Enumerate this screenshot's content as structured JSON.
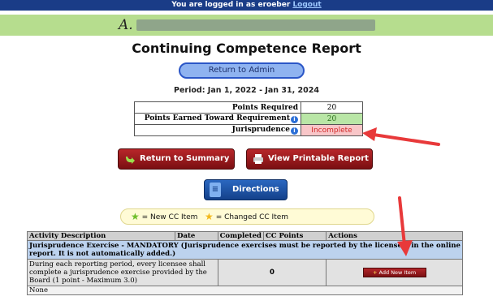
{
  "header": {
    "login_text": "You are logged in as eroeber",
    "logout_label": "Logout",
    "user_initial": "A."
  },
  "page": {
    "title": "Continuing Competence Report",
    "return_admin_label": "Return to Admin",
    "period": "Period: Jan 1, 2022 - Jan 31, 2024"
  },
  "points": {
    "required_label": "Points Required",
    "required_value": "20",
    "earned_label": "Points Earned Toward Requirement",
    "earned_value": "20",
    "jurisprudence_label": "Jurisprudence",
    "jurisprudence_value": "Incomplete"
  },
  "buttons": {
    "return_summary": "Return to Summary",
    "view_printable": "View Printable Report",
    "directions": "Directions"
  },
  "legend": {
    "new_item": "= New CC Item",
    "changed_item": "= Changed CC Item"
  },
  "activities": {
    "headers": [
      "Activity Description",
      "Date",
      "Completed",
      "CC Points",
      "Actions"
    ],
    "section_title": "Jurisprudence Exercise - MANDATORY (Jurisprudence exercises must be reported by the licensee, in the online report. It is not automatically added.)",
    "item_description": "During each reporting period, every licensee shall complete a jurisprudence exercise provided by the Board (1 point - Maximum 3.0)",
    "item_completed": "0",
    "add_button": "Add New Item",
    "none_text": "None"
  },
  "colors": {
    "arrow": "#e8393a",
    "login_bar": "#1a3c87",
    "name_bar": "#b6dd8e"
  }
}
